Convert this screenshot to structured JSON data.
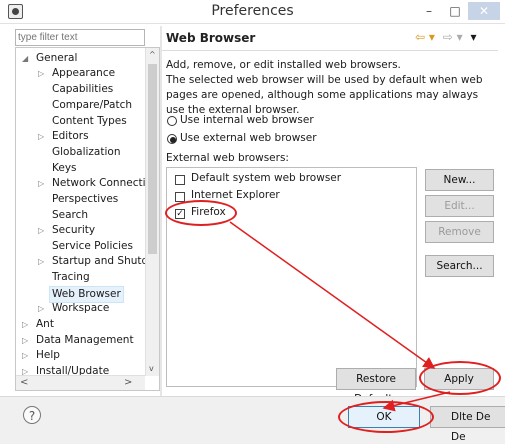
{
  "window": {
    "title": "Preferences",
    "minimize": "–",
    "maximize": "□",
    "close": "✕"
  },
  "filter": {
    "placeholder": "type filter text"
  },
  "tree": {
    "items": [
      {
        "label": "General",
        "expanded": true
      },
      {
        "label": "Appearance",
        "expandable": true
      },
      {
        "label": "Capabilities"
      },
      {
        "label": "Compare/Patch"
      },
      {
        "label": "Content Types"
      },
      {
        "label": "Editors",
        "expandable": true
      },
      {
        "label": "Globalization"
      },
      {
        "label": "Keys"
      },
      {
        "label": "Network Connecti",
        "expandable": true
      },
      {
        "label": "Perspectives"
      },
      {
        "label": "Search"
      },
      {
        "label": "Security",
        "expandable": true
      },
      {
        "label": "Service Policies"
      },
      {
        "label": "Startup and Shutd",
        "expandable": true
      },
      {
        "label": "Tracing"
      },
      {
        "label": "Web Browser",
        "selected": true
      },
      {
        "label": "Workspace",
        "expandable": true
      },
      {
        "label": "Ant",
        "expandable": true
      },
      {
        "label": "Data Management",
        "expandable": true
      },
      {
        "label": "Help",
        "expandable": true
      },
      {
        "label": "Install/Update",
        "expandable": true
      }
    ]
  },
  "page": {
    "title": "Web Browser",
    "nav_back": "⇦ ▾",
    "nav_forward": "⇨ ▾",
    "nav_menu": "▾",
    "description": "Add, remove, or edit installed web browsers.\nThe selected web browser will be used by default when web pages are opened, although some applications may always use the external browser.",
    "radio_internal": "Use internal web browser",
    "radio_external": "Use external web browser",
    "selected_mode": "external",
    "list_label": "External web browsers:",
    "browsers": [
      {
        "label": "Default system web browser",
        "checked": false
      },
      {
        "label": "Internet Explorer",
        "checked": false
      },
      {
        "label": "Firefox",
        "checked": true
      }
    ],
    "buttons": {
      "new": "New...",
      "edit": "Edit...",
      "remove": "Remove",
      "search": "Search..."
    },
    "restore_defaults": "Restore Defaults",
    "apply": "Apply"
  },
  "footer": {
    "help": "?",
    "ok": "OK",
    "cancel_partial": "Dlte De De"
  },
  "annotation_color": "#e02020"
}
